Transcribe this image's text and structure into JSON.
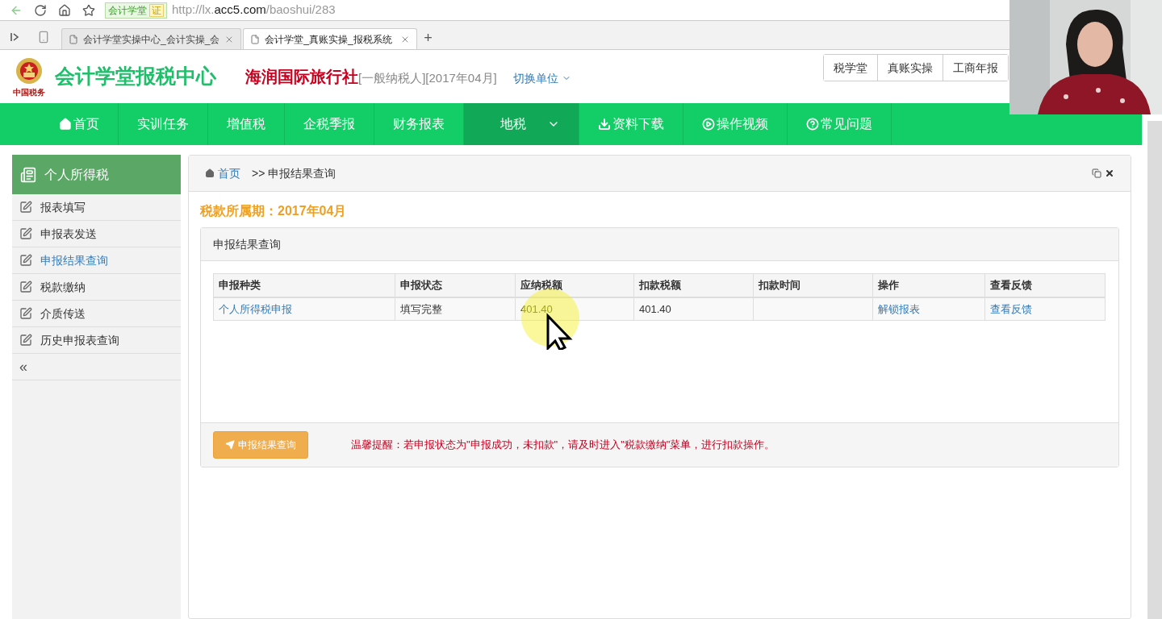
{
  "browser": {
    "site_badge": "会计学堂",
    "cert_badge": "证",
    "url": {
      "scheme": "http://lx.",
      "domain": "acc5.com",
      "path": "/baoshui/283"
    },
    "tabs": [
      {
        "label": "会计学堂实操中心_会计实操_会",
        "selected": false
      },
      {
        "label": "会计学堂_真账实操_报税系统",
        "selected": true
      }
    ],
    "new_tab": "+"
  },
  "header": {
    "emblem_caption": "中国税务",
    "site_title": "会计学堂报税中心",
    "company": "海润国际旅行社",
    "company_info": "[一般纳税人][2017年04月]",
    "switch_unit": "切换单位",
    "top_links": [
      "税学堂",
      "真账实操",
      "工商年报"
    ]
  },
  "nav": [
    {
      "label": "首页",
      "kind": "home",
      "selected": false,
      "dropdown": false
    },
    {
      "label": "实训任务",
      "kind": "plain",
      "selected": false,
      "dropdown": false
    },
    {
      "label": "增值税",
      "kind": "plain",
      "selected": false,
      "dropdown": false
    },
    {
      "label": "企税季报",
      "kind": "plain",
      "selected": false,
      "dropdown": false
    },
    {
      "label": "财务报表",
      "kind": "plain",
      "selected": false,
      "dropdown": false
    },
    {
      "label": "地税",
      "kind": "plain",
      "selected": true,
      "dropdown": true
    },
    {
      "label": "资料下载",
      "kind": "download",
      "selected": false,
      "dropdown": false
    },
    {
      "label": "操作视频",
      "kind": "video",
      "selected": false,
      "dropdown": false
    },
    {
      "label": "常见问题",
      "kind": "help",
      "selected": false,
      "dropdown": false
    }
  ],
  "sidebar": {
    "title": "个人所得税",
    "items": [
      {
        "label": "报表填写",
        "selected": false
      },
      {
        "label": "申报表发送",
        "selected": false
      },
      {
        "label": "申报结果查询",
        "selected": true
      },
      {
        "label": "税款缴纳",
        "selected": false
      },
      {
        "label": "介质传送",
        "selected": false
      },
      {
        "label": "历史申报表查询",
        "selected": false
      }
    ],
    "collapse": "«"
  },
  "breadcrumb": {
    "home": "首页",
    "current": ">> 申报结果查询"
  },
  "period": "税款所属期：2017年04月",
  "panel": {
    "title": "申报结果查询",
    "table": {
      "columns": [
        "申报种类",
        "申报状态",
        "应纳税额",
        "扣款税额",
        "扣款时间",
        "操作",
        "查看反馈"
      ],
      "rows": [
        [
          {
            "kind": "link",
            "text": "个人所得税申报"
          },
          {
            "kind": "text",
            "text": "填写完整"
          },
          {
            "kind": "text",
            "text": "401.40"
          },
          {
            "kind": "text",
            "text": "401.40"
          },
          {
            "kind": "empty"
          },
          {
            "kind": "link",
            "text": "解锁报表"
          },
          {
            "kind": "link",
            "text": "查看反馈"
          }
        ]
      ]
    },
    "button": "申报结果查询",
    "notice": "温馨提醒：若申报状态为\"申报成功，未扣款\"，请及时进入\"税款缴纳\"菜单，进行扣款操作。"
  }
}
